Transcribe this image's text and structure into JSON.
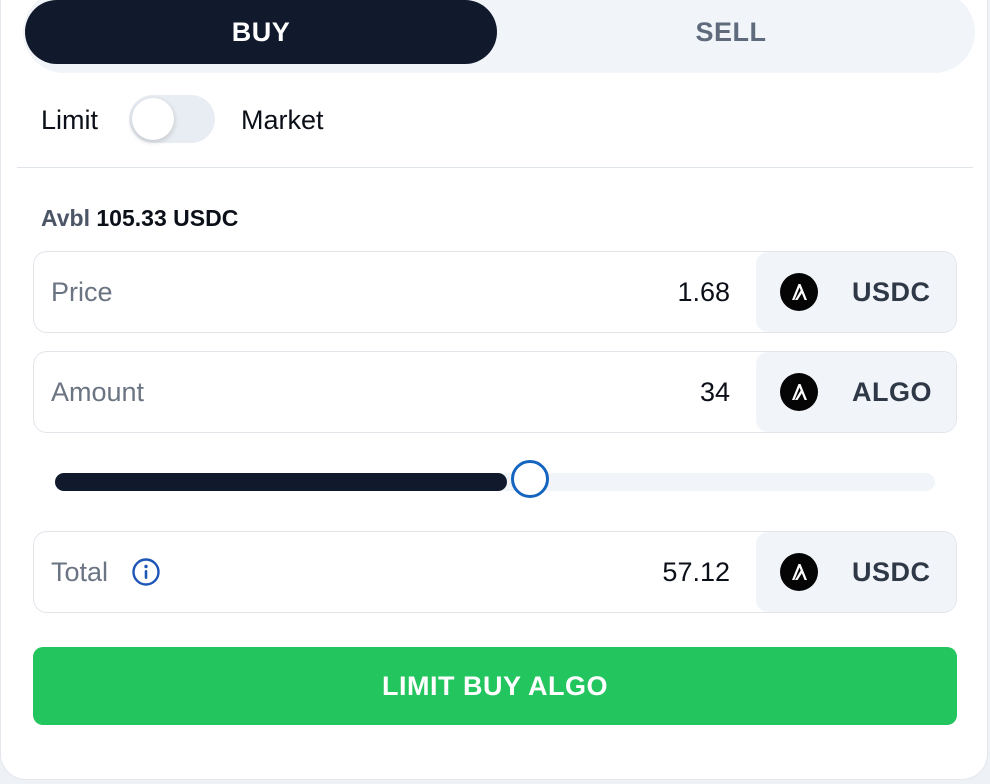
{
  "tabs": {
    "buy_label": "BUY",
    "sell_label": "SELL",
    "active": "BUY"
  },
  "order_type": {
    "limit_label": "Limit",
    "market_label": "Market",
    "selected": "Limit"
  },
  "available": {
    "label": "Avbl",
    "value": "105.33 USDC"
  },
  "fields": {
    "price": {
      "label": "Price",
      "value": "1.68",
      "unit": "USDC",
      "unit_icon": "algorand-logo-icon"
    },
    "amount": {
      "label": "Amount",
      "value": "34",
      "unit": "ALGO",
      "unit_icon": "algorand-logo-icon"
    },
    "total": {
      "label": "Total",
      "value": "57.12",
      "unit": "USDC",
      "unit_icon": "algorand-logo-icon",
      "info_icon": "info-icon"
    }
  },
  "slider": {
    "fraction": 0.54
  },
  "submit": {
    "label": "LIMIT BUY ALGO"
  },
  "colors": {
    "buy_active_bg": "#111a2c",
    "submit_green": "#22c55e",
    "slider_thumb_border": "#1565c0",
    "info_blue": "#1e56b8"
  }
}
